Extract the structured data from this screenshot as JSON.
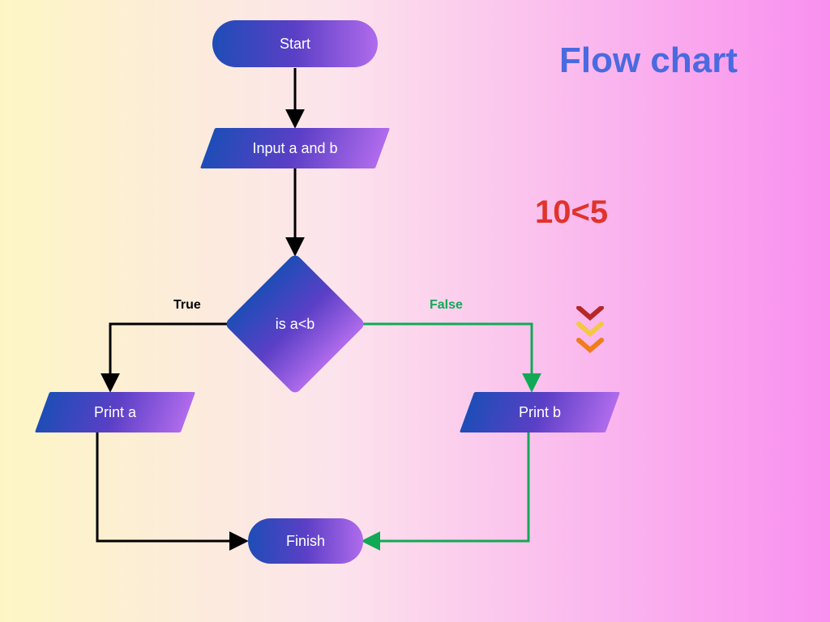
{
  "title": "Flow chart",
  "annotation": "10<5",
  "nodes": {
    "start": "Start",
    "input": "Input a and b",
    "decision": "is a<b",
    "print_a": "Print a",
    "print_b": "Print b",
    "finish": "Finish"
  },
  "edges": {
    "true_label": "True",
    "false_label": "False"
  },
  "colors": {
    "true_path": "#000000",
    "false_path": "#11a956",
    "title": "#4a6ae0",
    "annotation": "#e0332c"
  }
}
